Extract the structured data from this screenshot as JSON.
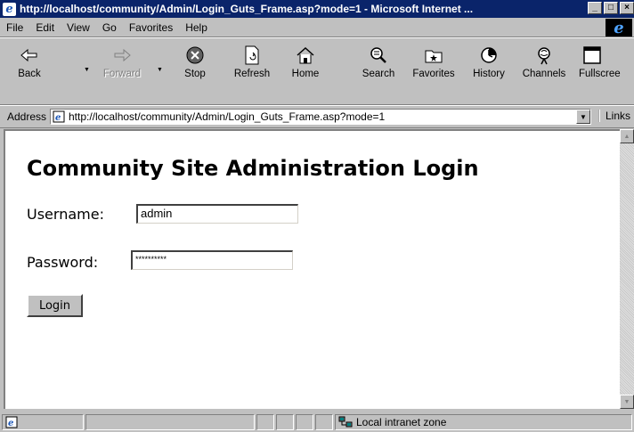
{
  "window": {
    "title": "http://localhost/community/Admin/Login_Guts_Frame.asp?mode=1 - Microsoft Internet ...",
    "minimize": "_",
    "maximize": "□",
    "close": "×"
  },
  "menu": [
    {
      "label": "File"
    },
    {
      "label": "Edit"
    },
    {
      "label": "View"
    },
    {
      "label": "Go"
    },
    {
      "label": "Favorites"
    },
    {
      "label": "Help"
    }
  ],
  "ie_logo": "e",
  "toolbar": {
    "back": "Back",
    "forward": "Forward",
    "stop": "Stop",
    "refresh": "Refresh",
    "home": "Home",
    "search": "Search",
    "favorites": "Favorites",
    "history": "History",
    "channels": "Channels",
    "fullscreen": "Fullscree"
  },
  "address": {
    "label": "Address",
    "url": "http://localhost/community/Admin/Login_Guts_Frame.asp?mode=1",
    "links": "Links"
  },
  "page": {
    "title": "Community Site Administration Login",
    "username_label": "Username:",
    "username_value": "admin",
    "password_label": "Password:",
    "password_value": "**********",
    "login_button": "Login"
  },
  "status": {
    "zone": "Local intranet zone"
  },
  "icons": {
    "page": "ie-page-icon",
    "zone": "intranet-zone-icon"
  }
}
